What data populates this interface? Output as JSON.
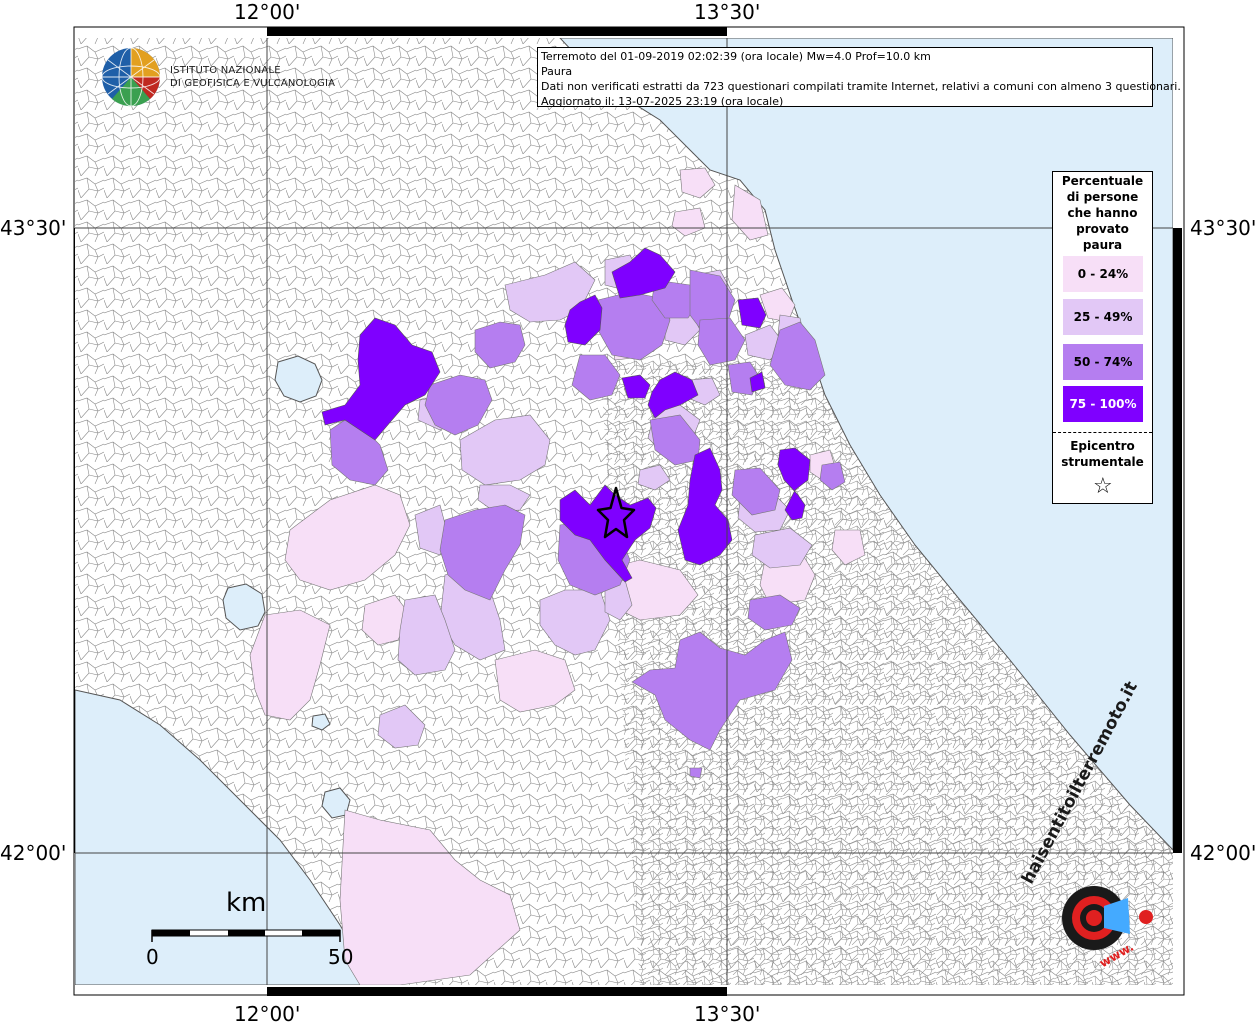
{
  "axes": {
    "lon_top": [
      "12°00'",
      "13°30'"
    ],
    "lon_bottom": [
      "12°00'",
      "13°30'"
    ],
    "lat_left": [
      "43°30'",
      "42°00'"
    ],
    "lat_right": [
      "43°30'",
      "42°00'"
    ]
  },
  "info": {
    "line1": "Terremoto del 01-09-2019 02:02:39 (ora locale) Mw=4.0 Prof=10.0 km",
    "line2": "Paura",
    "line3": "Dati non verificati estratti da 723 questionari compilati tramite Internet, relativi a comuni con almeno 3 questionari.",
    "line4": "Aggiornato il: 13-07-2025 23:19 (ora locale)"
  },
  "institute": {
    "line1": "ISTITUTO NAZIONALE",
    "line2": "DI GEOFISICA E VULCANOLOGIA"
  },
  "legend": {
    "title_lines": [
      "Percentuale",
      "di persone",
      "che hanno",
      "provato",
      "paura"
    ],
    "items": [
      {
        "label": "0 - 24%",
        "color": "#f7dff7",
        "text_color": "#000000"
      },
      {
        "label": "25 - 49%",
        "color": "#e2c8f6",
        "text_color": "#000000"
      },
      {
        "label": "50 - 74%",
        "color": "#b57ef0",
        "text_color": "#000000"
      },
      {
        "label": "75 - 100%",
        "color": "#7f00ff",
        "text_color": "#ffffff"
      }
    ],
    "epicenter_lines": [
      "Epicentro",
      "strumentale"
    ],
    "epicenter_symbol": "☆"
  },
  "scale": {
    "unit": "km",
    "start": "0",
    "end": "50"
  },
  "brand": {
    "text": "haisentitoilterremoto.it",
    "url_text": "www."
  },
  "colors": {
    "sea": "#ddeefa",
    "land": "#ffffff",
    "border": "#555555"
  }
}
